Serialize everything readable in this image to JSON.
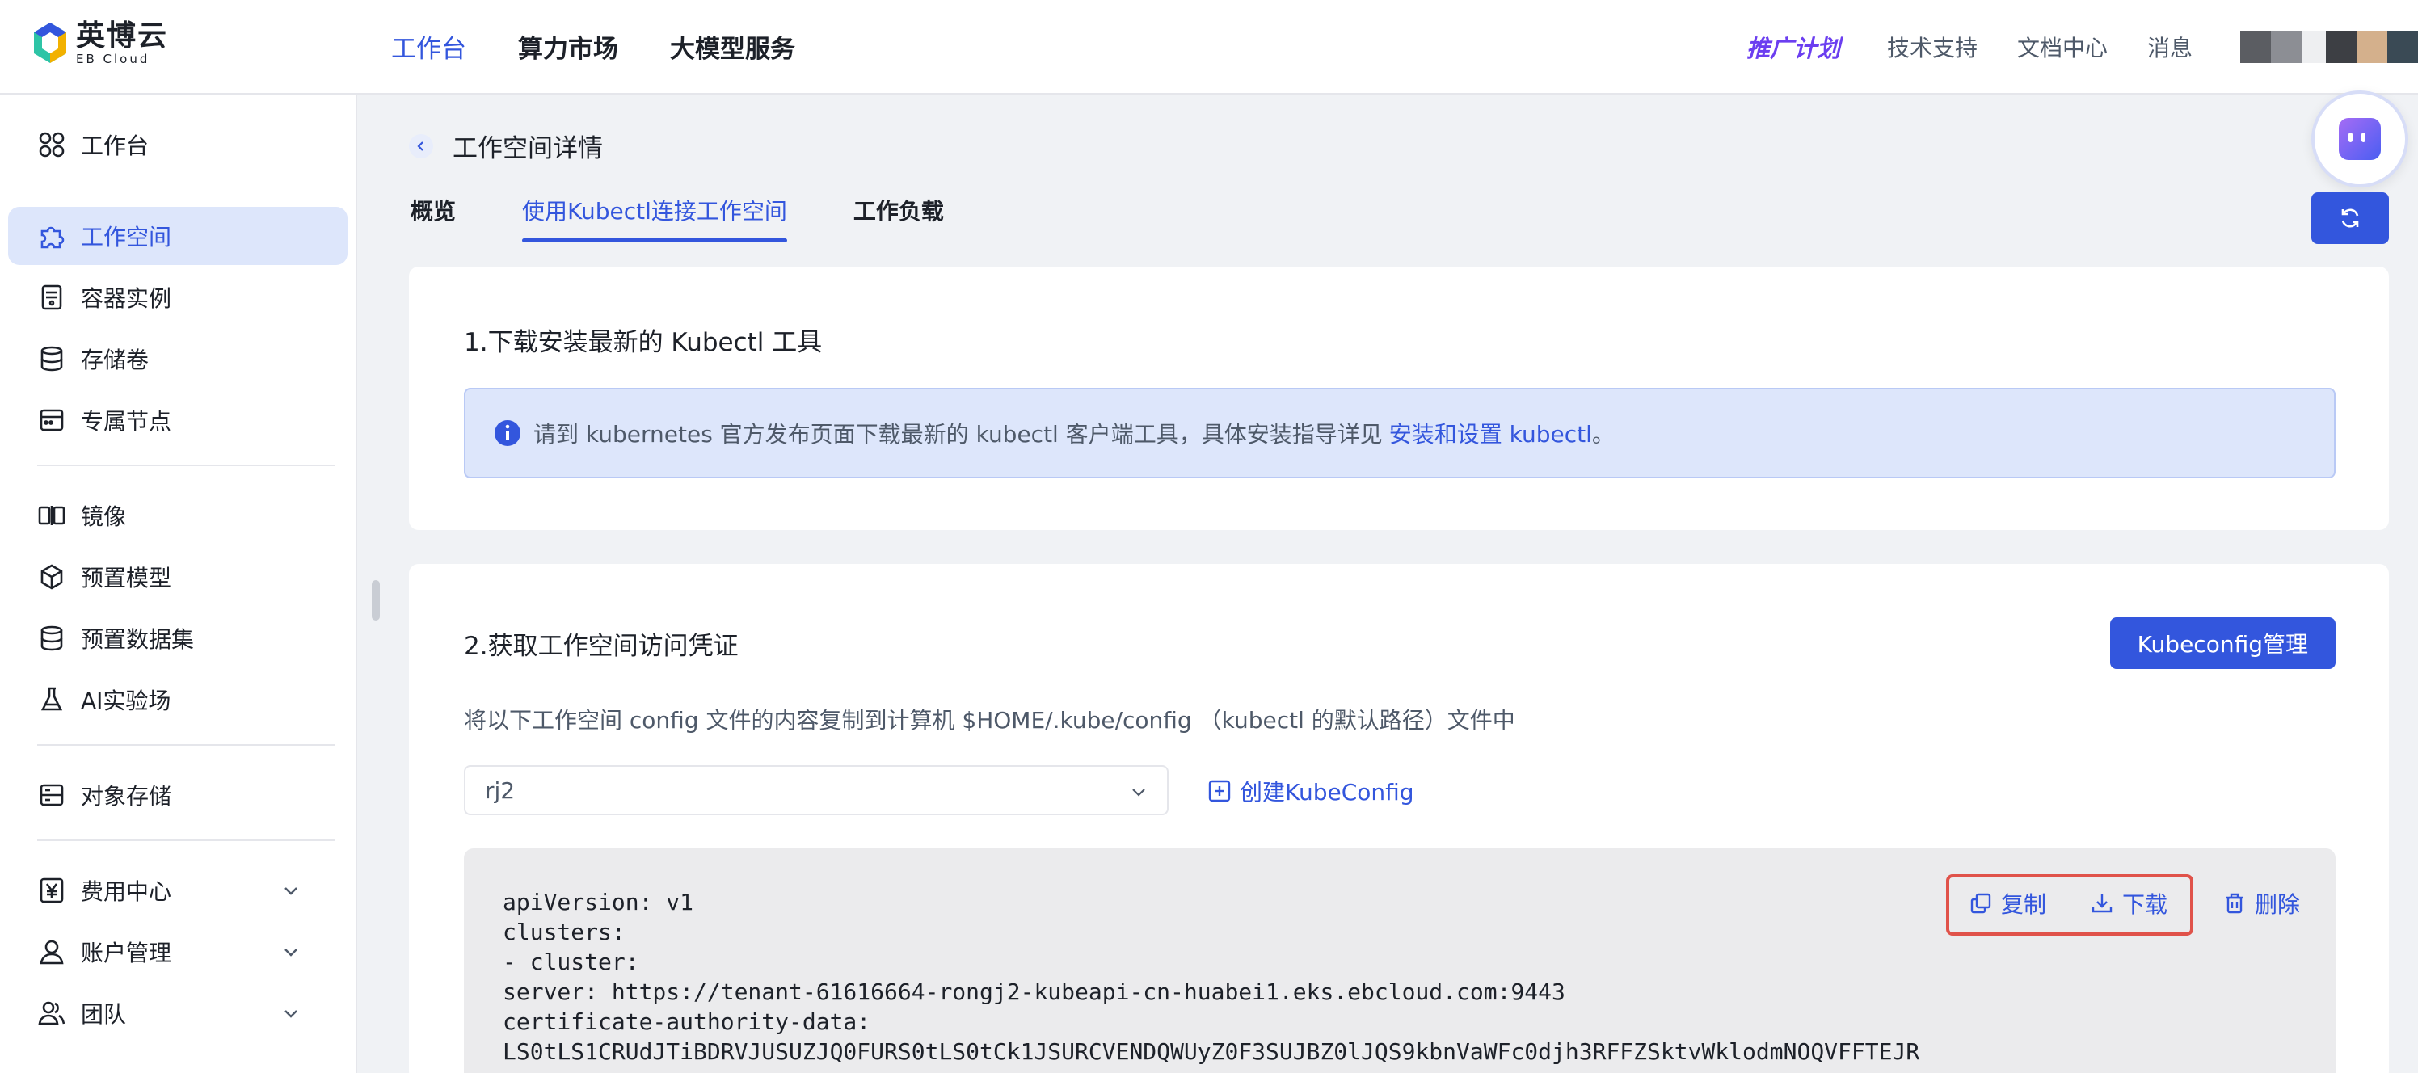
{
  "brand": {
    "name_cn": "英博云",
    "name_en": "EB Cloud"
  },
  "topnav": {
    "items": [
      "工作台",
      "算力市场",
      "大模型服务"
    ],
    "active": 0
  },
  "topright": {
    "promo": "推广计划",
    "links": [
      "技术支持",
      "文档中心",
      "消息"
    ]
  },
  "sidebar": {
    "items": [
      {
        "label": "工作台",
        "icon": "dashboard-icon"
      },
      {
        "label": "工作空间",
        "icon": "workspace-icon",
        "active": true
      },
      {
        "label": "容器实例",
        "icon": "container-icon"
      },
      {
        "label": "存储卷",
        "icon": "storage-icon"
      },
      {
        "label": "专属节点",
        "icon": "node-icon"
      },
      {
        "label": "镜像",
        "icon": "image-icon"
      },
      {
        "label": "预置模型",
        "icon": "cube-icon"
      },
      {
        "label": "预置数据集",
        "icon": "database-icon"
      },
      {
        "label": "AI实验场",
        "icon": "flask-icon"
      },
      {
        "label": "对象存储",
        "icon": "object-storage-icon"
      },
      {
        "label": "费用中心",
        "icon": "yen-icon",
        "expandable": true
      },
      {
        "label": "账户管理",
        "icon": "user-icon",
        "expandable": true
      },
      {
        "label": "团队",
        "icon": "team-icon",
        "expandable": true
      }
    ]
  },
  "page": {
    "title": "工作空间详情",
    "tabs": [
      "概览",
      "使用Kubectl连接工作空间",
      "工作负载"
    ],
    "active_tab": 1
  },
  "section1": {
    "title": "1.下载安装最新的 Kubectl 工具",
    "info_text": "请到 kubernetes 官方发布页面下载最新的 kubectl 客户端工具，具体安装指导详见",
    "info_link": "安装和设置 kubectl",
    "info_end": "。"
  },
  "section2": {
    "title": "2.获取工作空间访问凭证",
    "manage_button": "Kubeconfig管理",
    "description": "将以下工作空间 config 文件的内容复制到计算机 $HOME/.kube/config （kubectl 的默认路径）文件中",
    "select_value": "rj2",
    "create_link": "创建KubeConfig",
    "actions": {
      "copy": "复制",
      "download": "下载",
      "delete": "删除"
    },
    "code": "apiVersion: v1\nclusters:\n- cluster:\nserver: https://tenant-61616664-rongj2-kubeapi-cn-huabei1.eks.ebcloud.com:9443\ncertificate-authority-data:\nLS0tLS1CRUdJTiBDRVJUSUZJQ0FURS0tLS0tCk1JSURCVENDQWUyZ0F3SUJBZ0lJQS9kbnVaWFc0djh3RFFZSktvWklodmNOQVFFTEJR"
  },
  "colors": {
    "accent": "#3356dd",
    "highlight": "#e0524a",
    "info_bg": "#dde6fb"
  }
}
